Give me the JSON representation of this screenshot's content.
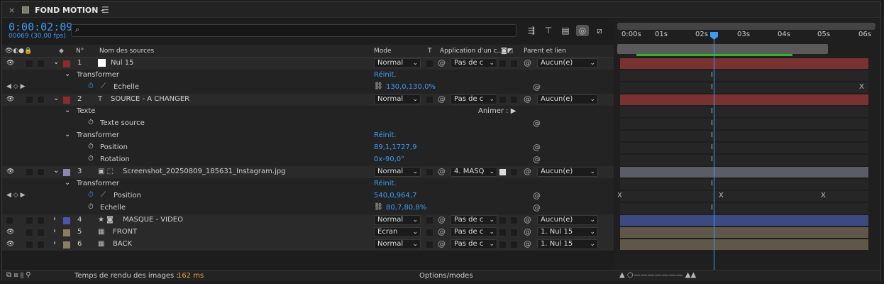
{
  "tab": {
    "close": "×",
    "title": "FOND MOTION -",
    "menu": "☰"
  },
  "timecode": "0:00:02:09",
  "frames": "00069 (30.00 fps)",
  "search": {
    "icon": "⌕",
    "placeholder": ""
  },
  "columns": {
    "num": "N°",
    "source": "Nom des sources",
    "mode": "Mode",
    "t": "T",
    "application": "Application d'un c...",
    "parent": "Parent et lien"
  },
  "rows": [
    {
      "kind": "layer",
      "num": "1",
      "name": "Nul 15",
      "mode": "Normal",
      "track": "Pas de c",
      "parent": "Aucun(e)",
      "label": "#8b2b2b",
      "color_swatch": "#ffffff"
    },
    {
      "kind": "group",
      "name": "Transformer",
      "value": "Réinit."
    },
    {
      "kind": "prop",
      "name": "Echelle",
      "value": "130,0,130,0%"
    },
    {
      "kind": "layer",
      "num": "2",
      "name": "SOURCE  - A CHANGER",
      "mode": "Normal",
      "track": "Pas de c",
      "parent": "Aucun(e)",
      "label": "#8b2b2b"
    },
    {
      "kind": "group",
      "name": "Texte",
      "value": "",
      "animate": "Animer :"
    },
    {
      "kind": "prop",
      "name": "Texte source",
      "value": ""
    },
    {
      "kind": "group",
      "name": "Transformer",
      "value": "Réinit."
    },
    {
      "kind": "prop",
      "name": "Position",
      "value": "89,1,1727,9"
    },
    {
      "kind": "prop",
      "name": "Rotation",
      "value": "0x-90,0°"
    },
    {
      "kind": "layer",
      "num": "3",
      "name": "Screenshot_20250809_185631_Instagram.jpg",
      "mode": "Normal",
      "track": "4. MASQ",
      "parent": "Aucun(e)",
      "label": "#8a86b0"
    },
    {
      "kind": "group",
      "name": "Transformer",
      "value": "Réinit."
    },
    {
      "kind": "prop",
      "name": "Position",
      "value": "540,0,964,7"
    },
    {
      "kind": "prop",
      "name": "Echelle",
      "value": "80,7,80,8%"
    },
    {
      "kind": "layer",
      "num": "4",
      "name": "MASQUE - VIDEO",
      "mode": "Normal",
      "track": "Pas de c",
      "parent": "Aucun(e)",
      "label": "#4a57a8"
    },
    {
      "kind": "layer",
      "num": "5",
      "name": "FRONT",
      "mode": "Ecran",
      "track": "Pas de c",
      "parent": "1. Nul 15",
      "label": "#8e7b62"
    },
    {
      "kind": "layer",
      "num": "6",
      "name": "BACK",
      "mode": "Normal",
      "track": "Pas de c",
      "parent": "1. Nul 15",
      "label": "#8e7b62"
    }
  ],
  "ruler": [
    "0:00s",
    "01s",
    "02s",
    "03s",
    "04s",
    "05s",
    "06s"
  ],
  "track_colors": {
    "1": "#7a3131",
    "2": "#7a3131",
    "3": "#5c5c66",
    "4": "#3d4a80",
    "5": "#5f5749",
    "6": "#5f5749"
  },
  "bottom": {
    "render_label": "Temps de rendu des images :",
    "render_value": "162 ms",
    "options": "Options/modes"
  }
}
